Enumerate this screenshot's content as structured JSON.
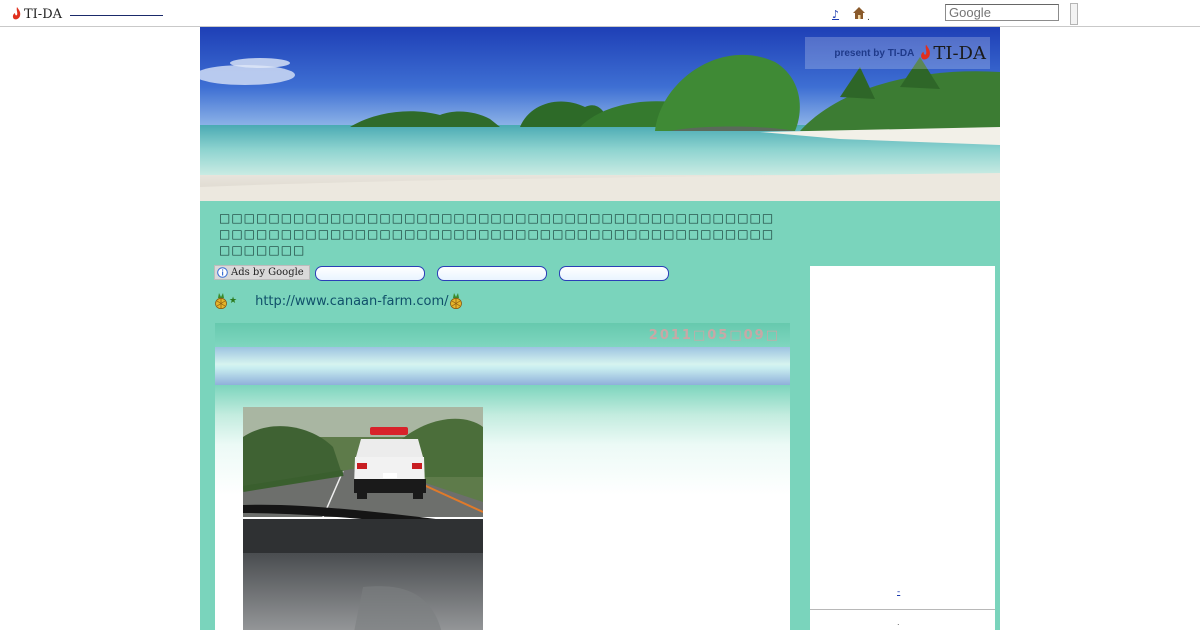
{
  "topbar": {
    "logo_text": "TI-DA",
    "music_link": "♪",
    "home_dot": ".",
    "search_placeholder": "Google"
  },
  "header": {
    "present_by": "present by TI-DA",
    "logo_text": "TI-DA"
  },
  "description": "□□□□□□□□□□□□□□□□□□□□□□□□□□□□□□□□□□□□□□□□□□□□□□□□□□□□□□□□□□□□□□□□□□□□□□□□□□□□□□□□□□□□□□□□□□□□□□□□□",
  "ads": {
    "ads_by_label": "Ads by Google",
    "links": [
      "",
      "",
      ""
    ]
  },
  "farm": {
    "star": "★",
    "url": "http://www.canaan-farm.com/"
  },
  "entry": {
    "date": "2011□05□09□"
  },
  "sidebar": {
    "link": "-",
    "dot": "."
  },
  "colors": {
    "page_bg": "#7ad4bc",
    "link": "#10506a",
    "date": "#c8a8a6"
  },
  "icons": [
    "flame-icon",
    "home-icon",
    "info-icon",
    "pineapple-icon"
  ]
}
